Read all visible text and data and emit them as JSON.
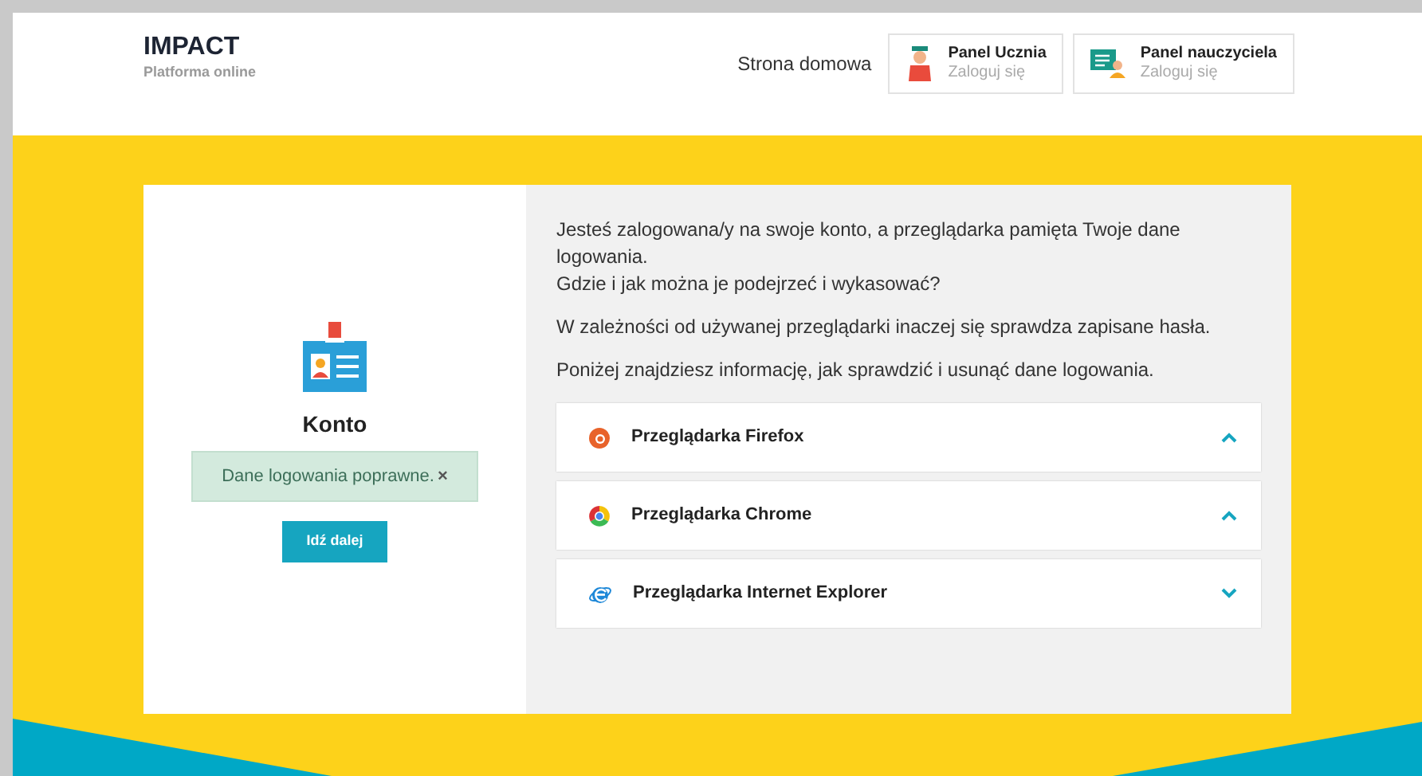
{
  "header": {
    "brand": "IMPACT",
    "tagline": "Platforma online",
    "home_link": "Strona domowa",
    "panels": [
      {
        "kind": "student",
        "title": "Panel Ucznia",
        "subtitle": "Zaloguj się"
      },
      {
        "kind": "teacher",
        "title": "Panel nauczyciela",
        "subtitle": "Zaloguj się"
      }
    ]
  },
  "account": {
    "title": "Konto",
    "alert": "Dane logowania poprawne.",
    "alert_close": "×",
    "button": "Idź dalej"
  },
  "info": {
    "paragraphs": [
      "Jesteś zalogowana/y na swoje konto, a przeglądarka pamięta Twoje dane logowania.\nGdzie i jak można je podejrzeć i wykasować?",
      "W zależności od używanej przeglądarki inaczej się sprawdza zapisane hasła.",
      "Poniżej znajdziesz informację, jak sprawdzić i usunąć dane logowania."
    ],
    "browsers": [
      {
        "kind": "firefox",
        "label": "Przeglądarka Firefox",
        "expanded": true
      },
      {
        "kind": "chrome",
        "label": "Przeglądarka Chrome",
        "expanded": true
      },
      {
        "kind": "ie",
        "label": "Przeglądarka Internet Explorer",
        "expanded": false
      }
    ]
  }
}
